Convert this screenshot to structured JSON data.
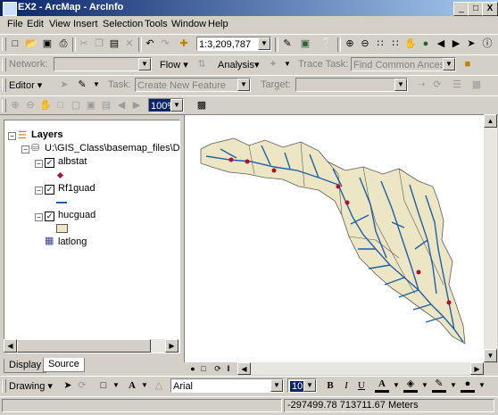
{
  "window": {
    "title": "EX2 - ArcMap - ArcInfo",
    "min": "_",
    "max": "□",
    "close": "X"
  },
  "menu": [
    "File",
    "Edit",
    "View",
    "Insert",
    "Selection",
    "Tools",
    "Window",
    "Help"
  ],
  "standard_toolbar": {
    "scale": "1:3,209,787"
  },
  "network_toolbar": {
    "network_label": "Network:",
    "flow_label": "Flow ▾",
    "analysis_label": "Analysis▾",
    "trace_task_label": "Trace Task:",
    "trace_task_value": "Find Common Ancesto"
  },
  "editor_toolbar": {
    "editor_label": "Editor ▾",
    "task_label": "Task:",
    "task_value": "Create New Feature",
    "target_label": "Target:"
  },
  "layout_toolbar": {
    "zoom_percent": "100%"
  },
  "toc": {
    "root": "Layers",
    "data_frame": "U:\\GIS_Class\\basemap_files\\Data",
    "layers": [
      {
        "name": "albstat",
        "checked": true,
        "symbol": "point"
      },
      {
        "name": "Rf1guad",
        "checked": true,
        "symbol": "line"
      },
      {
        "name": "hucguad",
        "checked": true,
        "symbol": "polygon"
      },
      {
        "name": "latlong",
        "checked": false,
        "symbol": "table"
      }
    ]
  },
  "tabs": {
    "display": "Display",
    "source": "Source"
  },
  "drawing_toolbar": {
    "drawing_label": "Drawing ▾",
    "font_name": "Arial",
    "font_size": "10",
    "bold": "B",
    "italic": "I",
    "underline": "U",
    "font_color_label": "A"
  },
  "status": {
    "coordinates": "-297499.78  713711.67 Meters"
  },
  "colors": {
    "titlebar_start": "#0a246a",
    "titlebar_end": "#a6caf0",
    "chrome": "#d4d0c8",
    "polygon_fill": "#ede6c4",
    "polygon_outline": "#5a5a5a",
    "river": "#1f5fa8",
    "station": "#b0102a"
  }
}
